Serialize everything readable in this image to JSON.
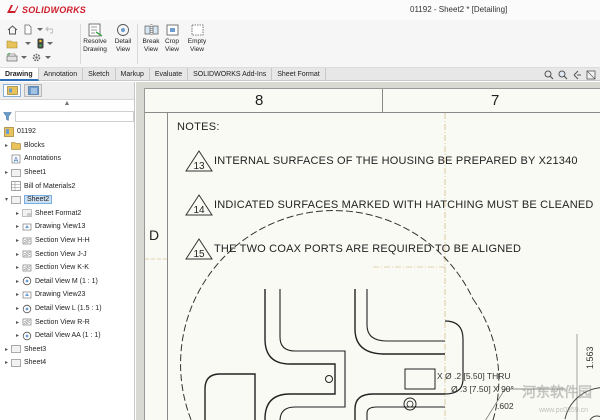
{
  "app": {
    "brand": "SOLIDWORKS",
    "window_title": "01192 - Sheet2 * [Detailing]"
  },
  "ribbon": {
    "tools": [
      {
        "id": "resolve-drawing",
        "label": "Resolve\nDrawing"
      },
      {
        "id": "detail-view",
        "label": "Detail\nView"
      },
      {
        "id": "break-view",
        "label": "Break\nView"
      },
      {
        "id": "crop-view",
        "label": "Crop\nView"
      },
      {
        "id": "empty-view",
        "label": "Empty\nView"
      }
    ]
  },
  "tabs": [
    "Drawing",
    "Annotation",
    "Sketch",
    "Markup",
    "Evaluate",
    "SOLIDWORKS Add-Ins",
    "Sheet Format"
  ],
  "active_tab": "Drawing",
  "tree": {
    "root": "01192",
    "items": [
      {
        "label": "Blocks",
        "depth": 1,
        "arrow": "▸",
        "icon": "folder-icon"
      },
      {
        "label": "Annotations",
        "depth": 1,
        "arrow": "",
        "icon": "annotation-icon"
      },
      {
        "label": "Sheet1",
        "depth": 1,
        "arrow": "▸",
        "icon": "sheet-icon"
      },
      {
        "label": "Bill of Materials2",
        "depth": 1,
        "arrow": "",
        "icon": "bom-icon"
      },
      {
        "label": "Sheet2",
        "depth": 1,
        "arrow": "▾",
        "icon": "sheet-icon",
        "selected": true
      },
      {
        "label": "Sheet Format2",
        "depth": 2,
        "arrow": "▸",
        "icon": "sheet-format-icon"
      },
      {
        "label": "Drawing View13",
        "depth": 2,
        "arrow": "▸",
        "icon": "drawing-view-icon"
      },
      {
        "label": "Section View H-H",
        "depth": 2,
        "arrow": "▸",
        "icon": "section-view-icon"
      },
      {
        "label": "Section View J-J",
        "depth": 2,
        "arrow": "▸",
        "icon": "section-view-icon"
      },
      {
        "label": "Section View K-K",
        "depth": 2,
        "arrow": "▸",
        "icon": "section-view-icon"
      },
      {
        "label": "Detail View M (1 : 1)",
        "depth": 2,
        "arrow": "▸",
        "icon": "detail-view-icon"
      },
      {
        "label": "Drawing View23",
        "depth": 2,
        "arrow": "▸",
        "icon": "drawing-view-icon"
      },
      {
        "label": "Detail View L (1.5 : 1)",
        "depth": 2,
        "arrow": "▸",
        "icon": "detail-view-icon"
      },
      {
        "label": "Section View R-R",
        "depth": 2,
        "arrow": "▸",
        "icon": "section-view-icon"
      },
      {
        "label": "Detail View AA (1 : 1)",
        "depth": 2,
        "arrow": "▸",
        "icon": "detail-view-icon"
      },
      {
        "label": "Sheet3",
        "depth": 1,
        "arrow": "▸",
        "icon": "sheet-icon"
      },
      {
        "label": "Sheet4",
        "depth": 1,
        "arrow": "▸",
        "icon": "sheet-icon"
      }
    ]
  },
  "drawing": {
    "zone_numbers": [
      "8",
      "7"
    ],
    "zone_letter": "D",
    "notes_title": "NOTES:",
    "notes": [
      {
        "num": "13",
        "text": "INTERNAL SURFACES OF THE HOUSING BE PREPARED BY X21340"
      },
      {
        "num": "14",
        "text": "INDICATED SURFACES MARKED WITH  HATCHING MUST BE CLEANED"
      },
      {
        "num": "15",
        "text": "THE TWO COAX PORTS ARE REQUIRED TO BE ALIGNED"
      }
    ],
    "dimensions": {
      "hole_callout": "X Ø .2 [5.50] THRU",
      "chamfer_callout": "Ø .3 [7.50] X 90°",
      "value_602": ".602",
      "value_1563": "1.563"
    },
    "watermark": "河东软件园",
    "watermark_url": "www.pc0359.cn"
  },
  "colors": {
    "brand_red": "#cf1f2c",
    "selection_blue": "#cce0f5",
    "sheet_paper": "#fafaf5",
    "canvas_bg": "#d9d9d3"
  }
}
